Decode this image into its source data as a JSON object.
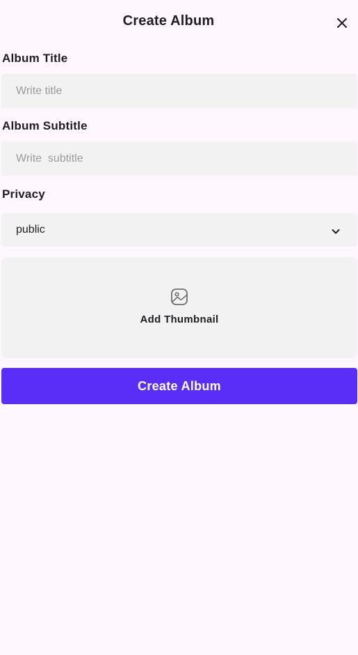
{
  "header": {
    "title": "Create Album",
    "close_icon": "close-icon"
  },
  "form": {
    "title_label": "Album Title",
    "title_placeholder": "Write title",
    "title_value": "",
    "subtitle_label": "Album Subtitle",
    "subtitle_placeholder": "Write  subtitle",
    "subtitle_value": "",
    "privacy_label": "Privacy",
    "privacy_value": "public",
    "privacy_icon": "chevron-down-icon",
    "thumbnail_label": "Add Thumbnail",
    "thumbnail_icon": "image-icon",
    "submit_label": "Create Album"
  },
  "colors": {
    "background": "#fdf7fd",
    "field_background": "#f2f2f2",
    "accent": "#5b2ef7",
    "text": "#1f1d22",
    "placeholder": "#9a9a9a"
  }
}
